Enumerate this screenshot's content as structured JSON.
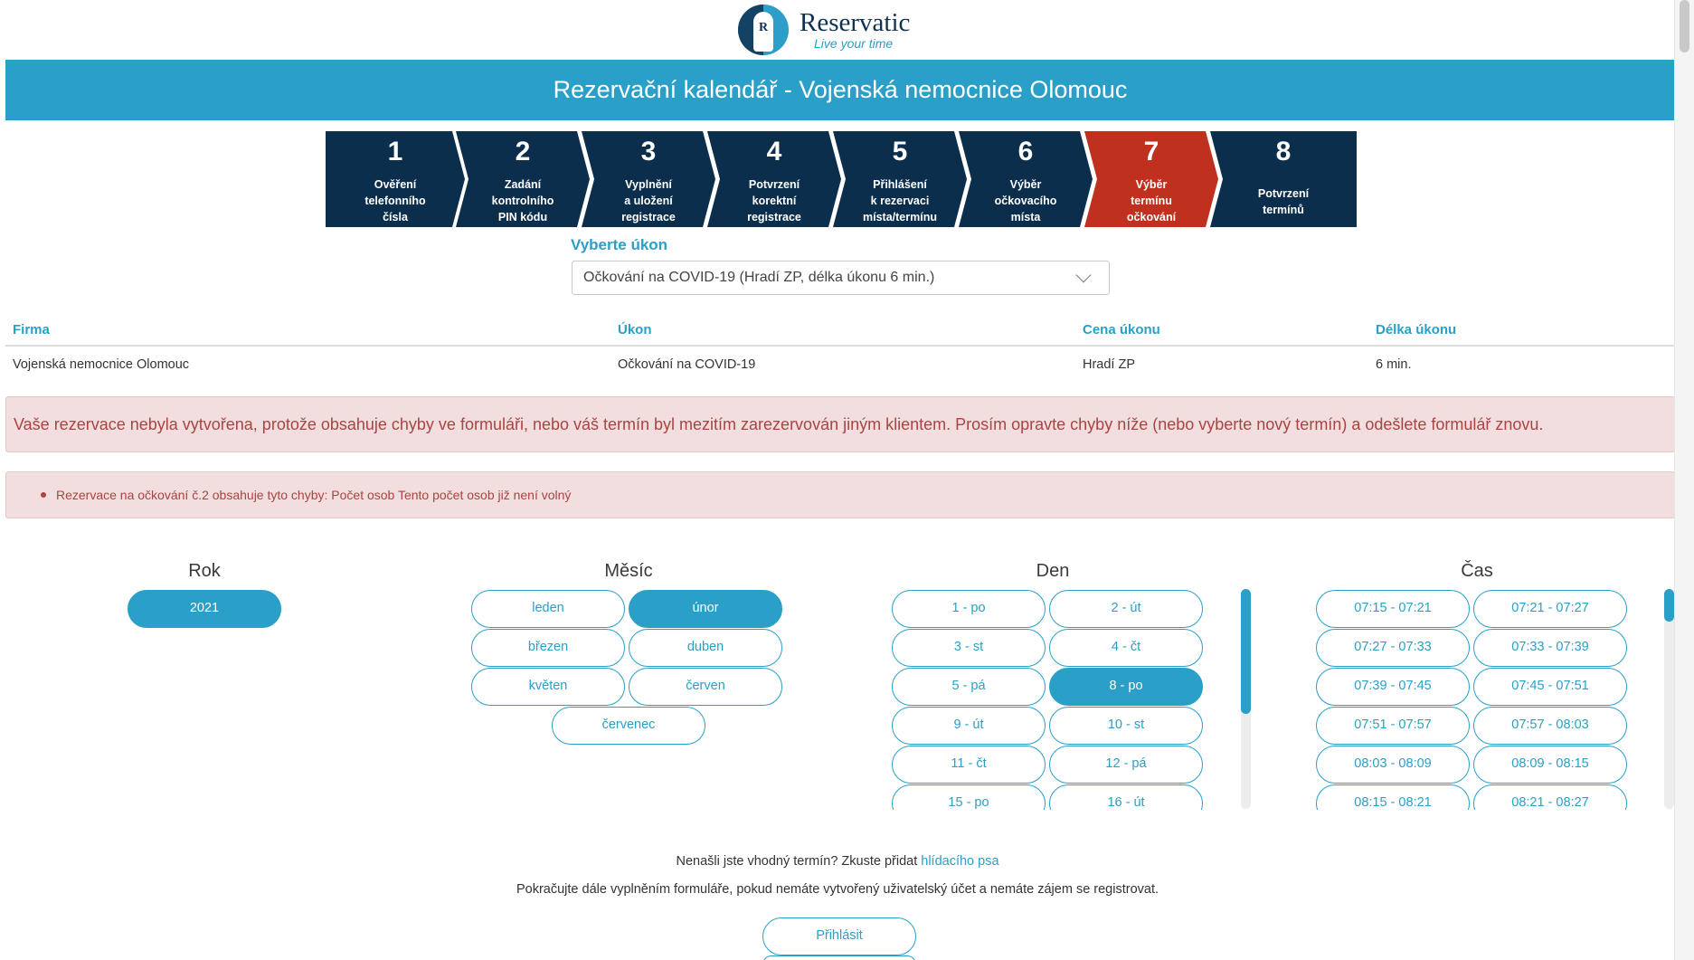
{
  "brand": {
    "name": "Reservatic",
    "tagline": "Live your time",
    "logo_letter": "R"
  },
  "title": "Rezervační kalendář - Vojenská nemocnice Olomouc",
  "steps": [
    {
      "num": "1",
      "label": "Ověření\ntelefonního\nčísla"
    },
    {
      "num": "2",
      "label": "Zadání\nkontrolního\nPIN kódu"
    },
    {
      "num": "3",
      "label": "Vyplnění\na uložení\nregistrace"
    },
    {
      "num": "4",
      "label": "Potvrzení\nkorektní\nregistrace"
    },
    {
      "num": "5",
      "label": "Přihlášení\nk rezervaci\nmísta/termínu"
    },
    {
      "num": "6",
      "label": "Výběr\nočkovacího\nmísta"
    },
    {
      "num": "7",
      "label": "Výběr\ntermínu\nočkování",
      "active": true
    },
    {
      "num": "8",
      "label": "Potvrzení\ntermínů"
    }
  ],
  "service": {
    "label": "Vyberte úkon",
    "selected": "Očkování na COVID-19 (Hradí ZP, délka úkonu 6 min.)"
  },
  "table": {
    "headers": [
      "Firma",
      "Úkon",
      "Cena úkonu",
      "Délka úkonu"
    ],
    "row": [
      "Vojenská nemocnice Olomouc",
      "Očkování na COVID-19",
      "Hradí ZP",
      "6 min."
    ]
  },
  "alerts": {
    "main": "Vaše rezervace nebyla vytvořena, protože obsahuje chyby ve formuláři, nebo váš termín byl mezitím zarezervován jiným klientem. Prosím opravte chyby níže (nebo vyberte nový termín) a odešlete formulář znovu.",
    "detail": "Rezervace na očkování č.2 obsahuje tyto chyby: Počet osob Tento počet osob již není volný"
  },
  "picker": {
    "year": {
      "title": "Rok",
      "items": [
        "2021"
      ],
      "selected": "2021"
    },
    "month": {
      "title": "Měsíc",
      "items": [
        "leden",
        "únor",
        "březen",
        "duben",
        "květen",
        "červen",
        "červenec"
      ],
      "selected": "únor"
    },
    "day": {
      "title": "Den",
      "items": [
        "1 - po",
        "2 - út",
        "3 - st",
        "4 - čt",
        "5 - pá",
        "8 - po",
        "9 - út",
        "10 - st",
        "11 - čt",
        "12 - pá",
        "15 - po",
        "16 - út"
      ],
      "selected": "8 - po"
    },
    "time": {
      "title": "Čas",
      "items": [
        "07:15 - 07:21",
        "07:21 - 07:27",
        "07:27 - 07:33",
        "07:33 - 07:39",
        "07:39 - 07:45",
        "07:45 - 07:51",
        "07:51 - 07:57",
        "07:57 - 08:03",
        "08:03 - 08:09",
        "08:09 - 08:15",
        "08:15 - 08:21",
        "08:21 - 08:27"
      ]
    }
  },
  "footer": {
    "watchdog_text": "Nenašli jste vhodný termín? Zkuste přidat",
    "watchdog_link": "hlídacího psa",
    "continue_text": "Pokračujte dále vyplněním formuláře, pokud nemáte vytvořený uživatelský účet a nemáte zájem se registrovat.",
    "login_label": "Přihlásit"
  },
  "colors": {
    "accent": "#2a9fc8",
    "navy": "#0c2e4d",
    "active_step": "#c0301f",
    "alert_bg": "#f2dede",
    "alert_text": "#a94442"
  }
}
